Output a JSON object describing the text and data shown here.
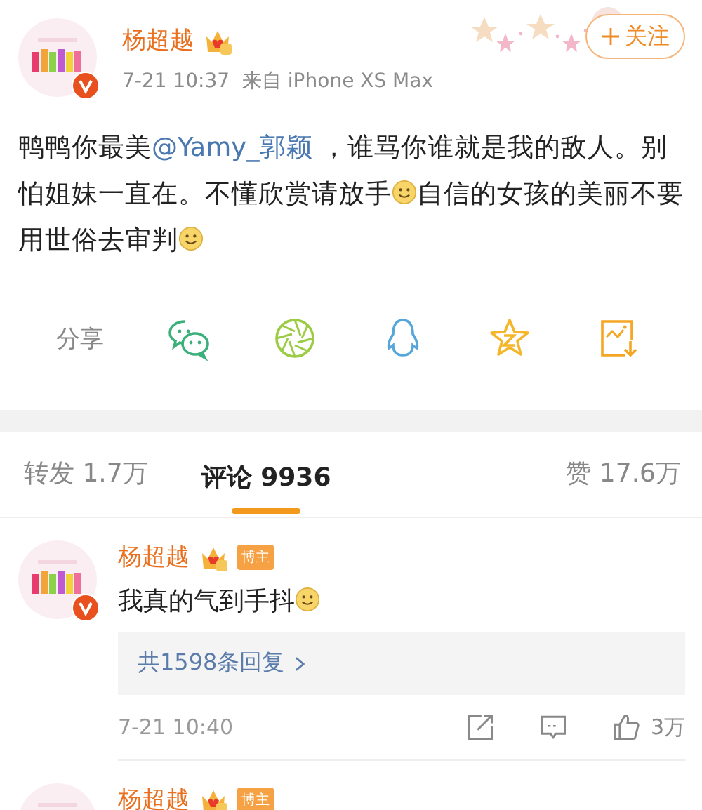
{
  "post": {
    "author": "杨超越",
    "verified": true,
    "meta": "7-21 10:37  来自 iPhone XS Max",
    "follow_button": "关注",
    "text": [
      {
        "kind": "text",
        "text": "鸭鸭你最美"
      },
      {
        "kind": "mention",
        "text": "@Yamy_郭颖"
      },
      {
        "kind": "text",
        "text": " ，谁骂你谁就是我的敌人。别怕姐妹一直在。不懂欣赏请放手"
      },
      {
        "kind": "emoji"
      },
      {
        "kind": "text",
        "text": "自信的女孩的美丽不要用世俗去审判"
      },
      {
        "kind": "emoji"
      }
    ],
    "share_label": "分享",
    "share_targets": [
      {
        "kind": "chat"
      },
      {
        "kind": "aperture"
      },
      {
        "kind": "penguin"
      },
      {
        "kind": "star"
      },
      {
        "kind": "save"
      }
    ]
  },
  "tabs": [
    {
      "label": "转发 1.7万",
      "selected": false
    },
    {
      "label": "评论 9936",
      "selected": true
    },
    {
      "label": "赞 17.6万",
      "selected": false
    }
  ],
  "comments": [
    {
      "author": "杨超越",
      "verified": true,
      "badge": "博主",
      "text": "我真的气到手抖",
      "emoji": true,
      "replies": "共1598条回复",
      "time": "7-21 10:40",
      "likes": "3万"
    },
    {
      "author": "杨超越",
      "badge": "博主"
    }
  ]
}
